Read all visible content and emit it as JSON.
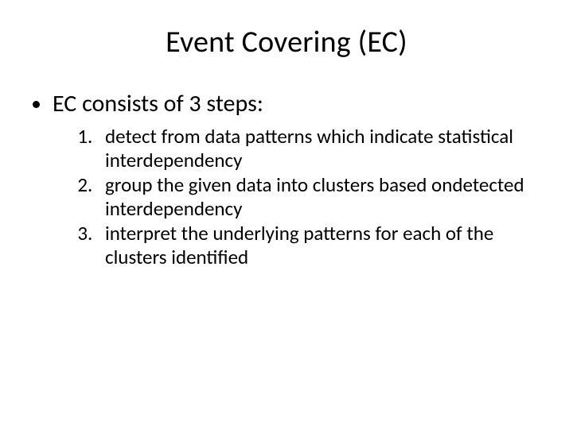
{
  "title": "Event Covering (EC)",
  "intro": "EC consists of 3 steps:",
  "steps": [
    "detect from data patterns which indicate statistical interdependency",
    "group the given data into clusters based ondetected interdependency",
    "interpret the underlying patterns for each of the clusters identified"
  ]
}
